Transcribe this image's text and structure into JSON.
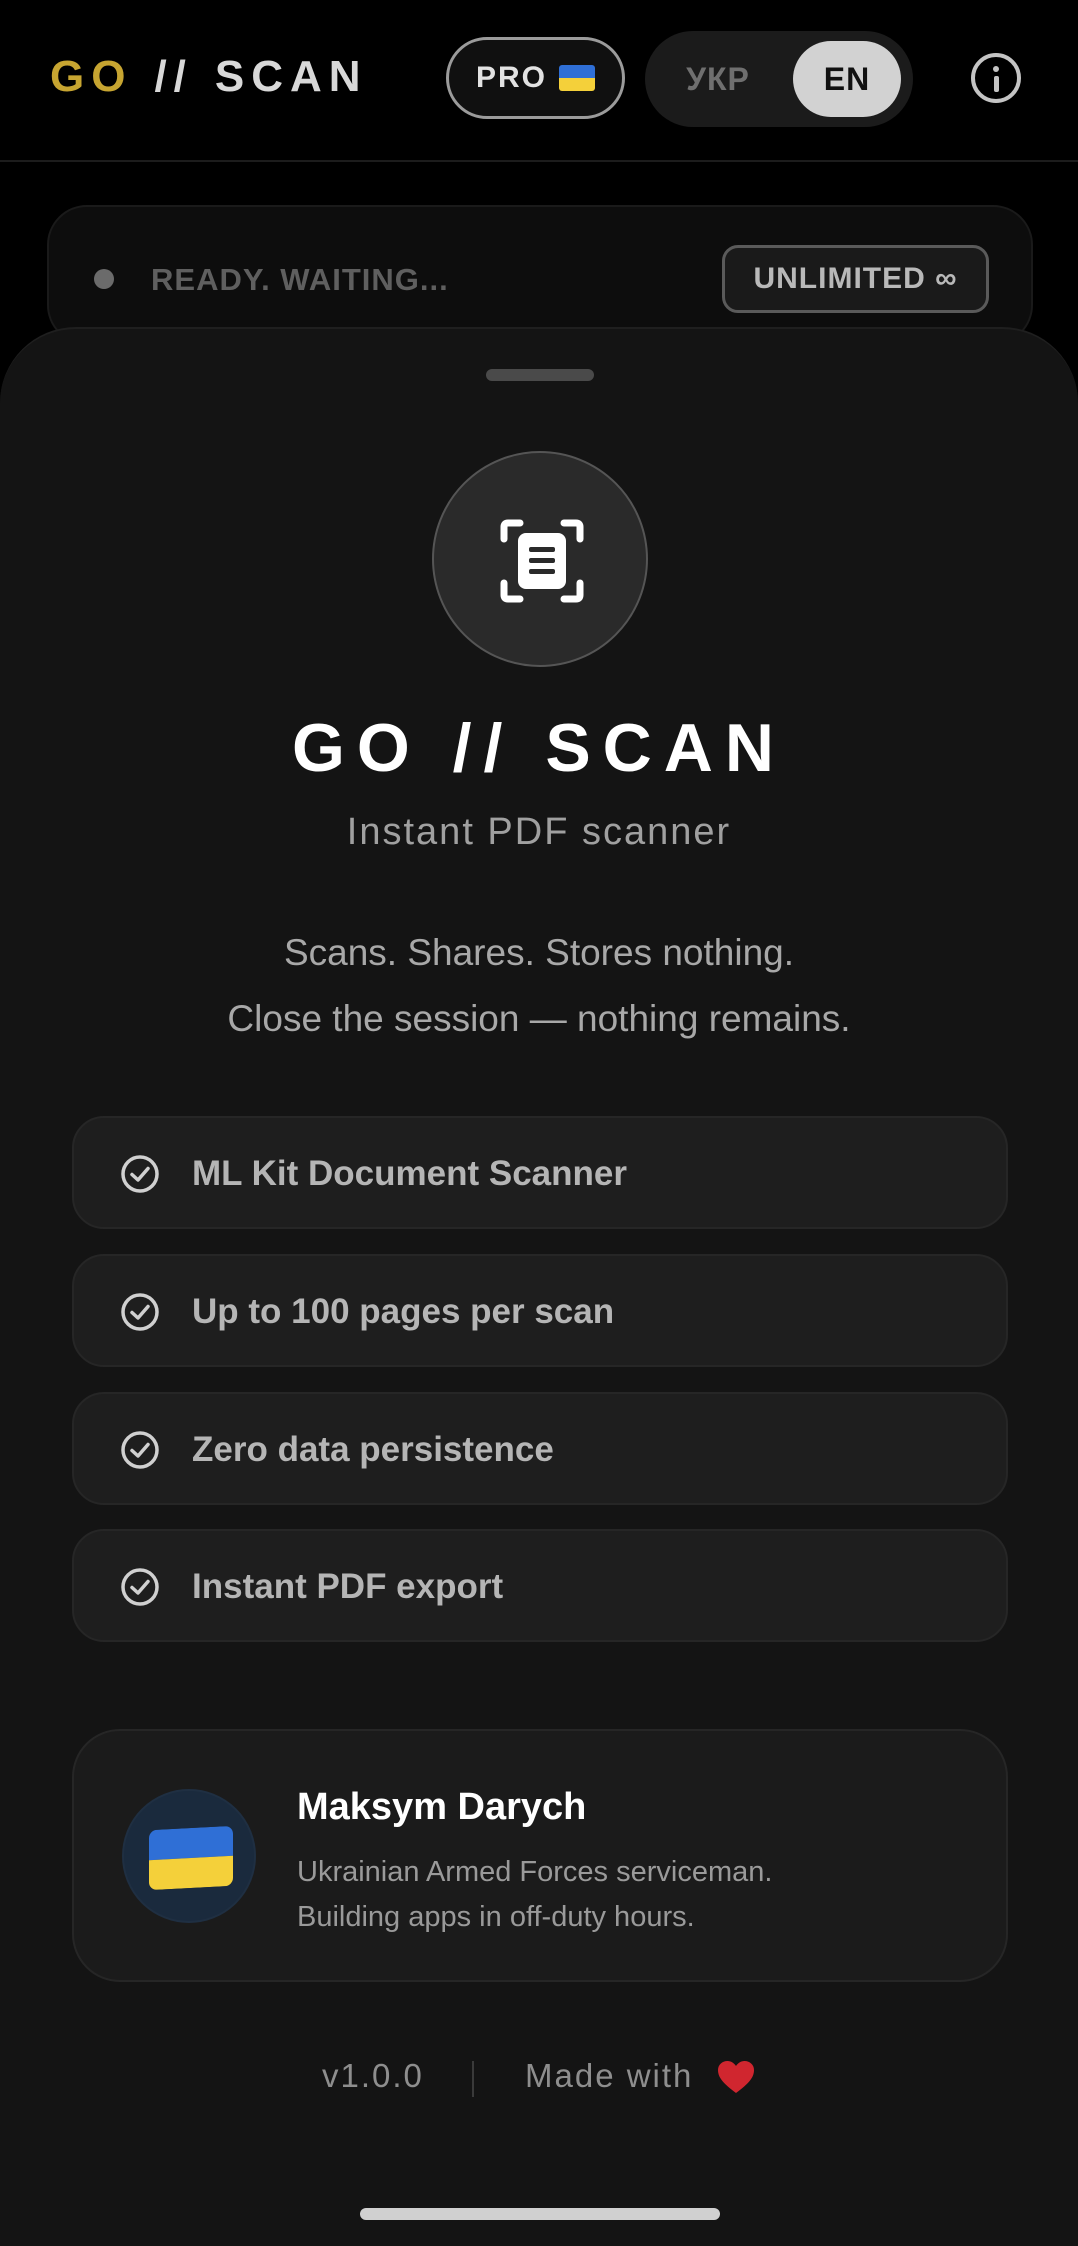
{
  "header": {
    "logo": {
      "go": "GO",
      "slash": "//",
      "scan": "SCAN"
    },
    "pro_label": "PRO",
    "pro_flag_icon": "ukraine-flag-icon",
    "languages": [
      {
        "code": "ukr",
        "label": "УКР",
        "selected": false
      },
      {
        "code": "en",
        "label": "EN",
        "selected": true
      }
    ],
    "info_icon": "info-circle-icon"
  },
  "status": {
    "text": "READY. WAITING...",
    "badge": "UNLIMITED ∞"
  },
  "sheet": {
    "app_icon": "document-scanner-icon",
    "title": "GO // SCAN",
    "subtitle": "Instant PDF scanner",
    "tagline_line1": "Scans. Shares. Stores nothing.",
    "tagline_line2": "Close the session — nothing remains.",
    "features": [
      {
        "icon": "check-circle-icon",
        "label": "ML Kit Document Scanner"
      },
      {
        "icon": "check-circle-icon",
        "label": "Up to 100 pages per scan"
      },
      {
        "icon": "check-circle-icon",
        "label": "Zero data persistence"
      },
      {
        "icon": "check-circle-icon",
        "label": "Instant PDF export"
      }
    ],
    "author": {
      "avatar_icon": "ukraine-flag-icon",
      "name": "Maksym Darych",
      "bio_line1": "Ukrainian Armed Forces serviceman.",
      "bio_line2": "Building apps in off-duty hours."
    },
    "footer": {
      "version": "v1.0.0",
      "made_with": "Made with",
      "heart_icon": "heart-icon"
    }
  },
  "colors": {
    "background": "#000000",
    "sheet": "#141414",
    "logo_accent": "#c7a531",
    "heart": "#d0262f",
    "flag_blue": "#2f6fd6",
    "flag_yellow": "#f4d03a"
  }
}
